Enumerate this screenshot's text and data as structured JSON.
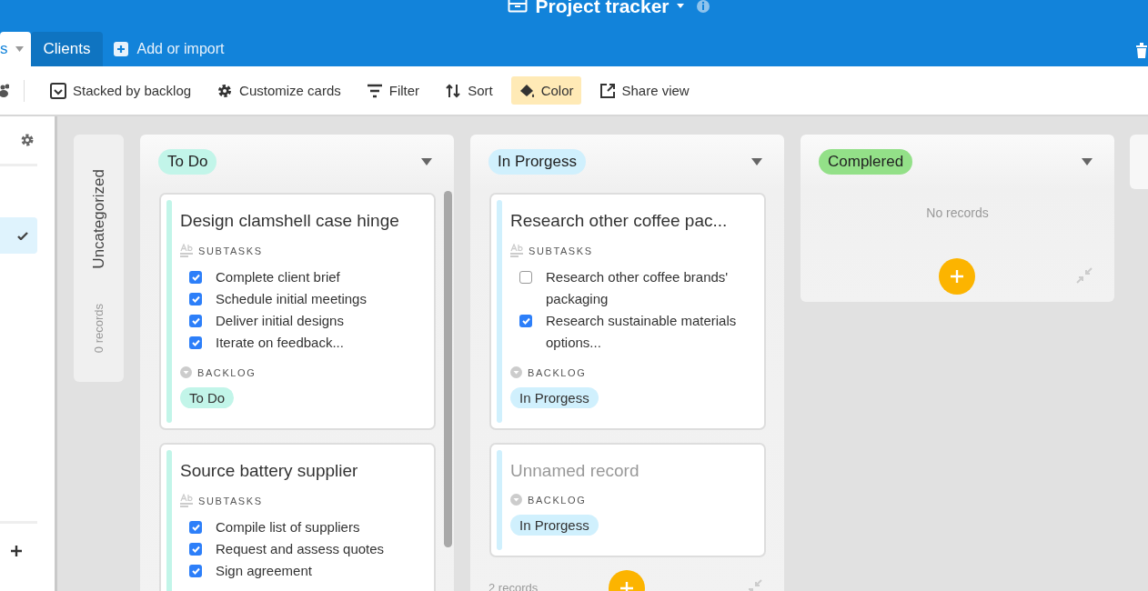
{
  "header": {
    "title": "Project tracker"
  },
  "tabs": [
    {
      "label": "s",
      "selected": true
    },
    {
      "label": "Clients",
      "selected": false
    }
  ],
  "add_tab": "Add or import",
  "toolbar": [
    {
      "kind": "stack",
      "label": "Stacked by backlog",
      "active": false
    },
    {
      "kind": "customize",
      "label": "Customize cards",
      "active": false
    },
    {
      "kind": "filter",
      "label": "Filter",
      "active": false
    },
    {
      "kind": "sort",
      "label": "Sort",
      "active": false
    },
    {
      "kind": "color",
      "label": "Color",
      "active": true
    },
    {
      "kind": "share",
      "label": "Share view",
      "active": false
    }
  ],
  "sidebar": {
    "items": [
      {
        "selected": true
      }
    ]
  },
  "board": {
    "collapsed": [
      {
        "title": "Uncategorized",
        "count": "0 records"
      }
    ],
    "stacks": [
      {
        "label": "To Do",
        "color": "#c2f5e9",
        "add_button": false,
        "cards": [
          {
            "title": "Design clamshell case hinge",
            "unnamed": false,
            "fields": [
              {
                "kind": "checklist",
                "label": "SUBTASKS",
                "items": [
                  {
                    "text": "Complete client brief",
                    "checked": true
                  },
                  {
                    "text": "Schedule initial meetings",
                    "checked": true
                  },
                  {
                    "text": "Deliver initial designs",
                    "checked": true
                  },
                  {
                    "text": "Iterate on feedback...",
                    "checked": true
                  }
                ]
              },
              {
                "kind": "select",
                "label": "BACKLOG",
                "value": "To Do",
                "color": "#c2f5e9"
              }
            ]
          },
          {
            "title": "Source battery supplier",
            "unnamed": false,
            "fields": [
              {
                "kind": "checklist",
                "label": "SUBTASKS",
                "items": [
                  {
                    "text": "Compile list of suppliers",
                    "checked": true
                  },
                  {
                    "text": "Request and assess quotes",
                    "checked": true
                  },
                  {
                    "text": "Sign agreement",
                    "checked": true
                  }
                ]
              }
            ]
          }
        ]
      },
      {
        "label": "In Prorgess",
        "color": "#d0f0fd",
        "add_button": true,
        "count": "2 records",
        "cards": [
          {
            "title": "Research other coffee pac...",
            "unnamed": false,
            "fields": [
              {
                "kind": "checklist",
                "label": "SUBTASKS",
                "items": [
                  {
                    "text": "Research other coffee brands' packaging",
                    "checked": false
                  },
                  {
                    "text": "Research sustainable materials options...",
                    "checked": true
                  }
                ]
              },
              {
                "kind": "select",
                "label": "BACKLOG",
                "value": "In Prorgess",
                "color": "#d0f0fd"
              }
            ]
          },
          {
            "title": "Unnamed record",
            "unnamed": true,
            "fields": [
              {
                "kind": "select",
                "label": "BACKLOG",
                "value": "In Prorgess",
                "color": "#d0f0fd"
              }
            ]
          }
        ]
      },
      {
        "label": "Complered",
        "color": "#93e088",
        "add_button": true,
        "empty_text": "No records"
      }
    ],
    "next_stack_edge": true
  }
}
